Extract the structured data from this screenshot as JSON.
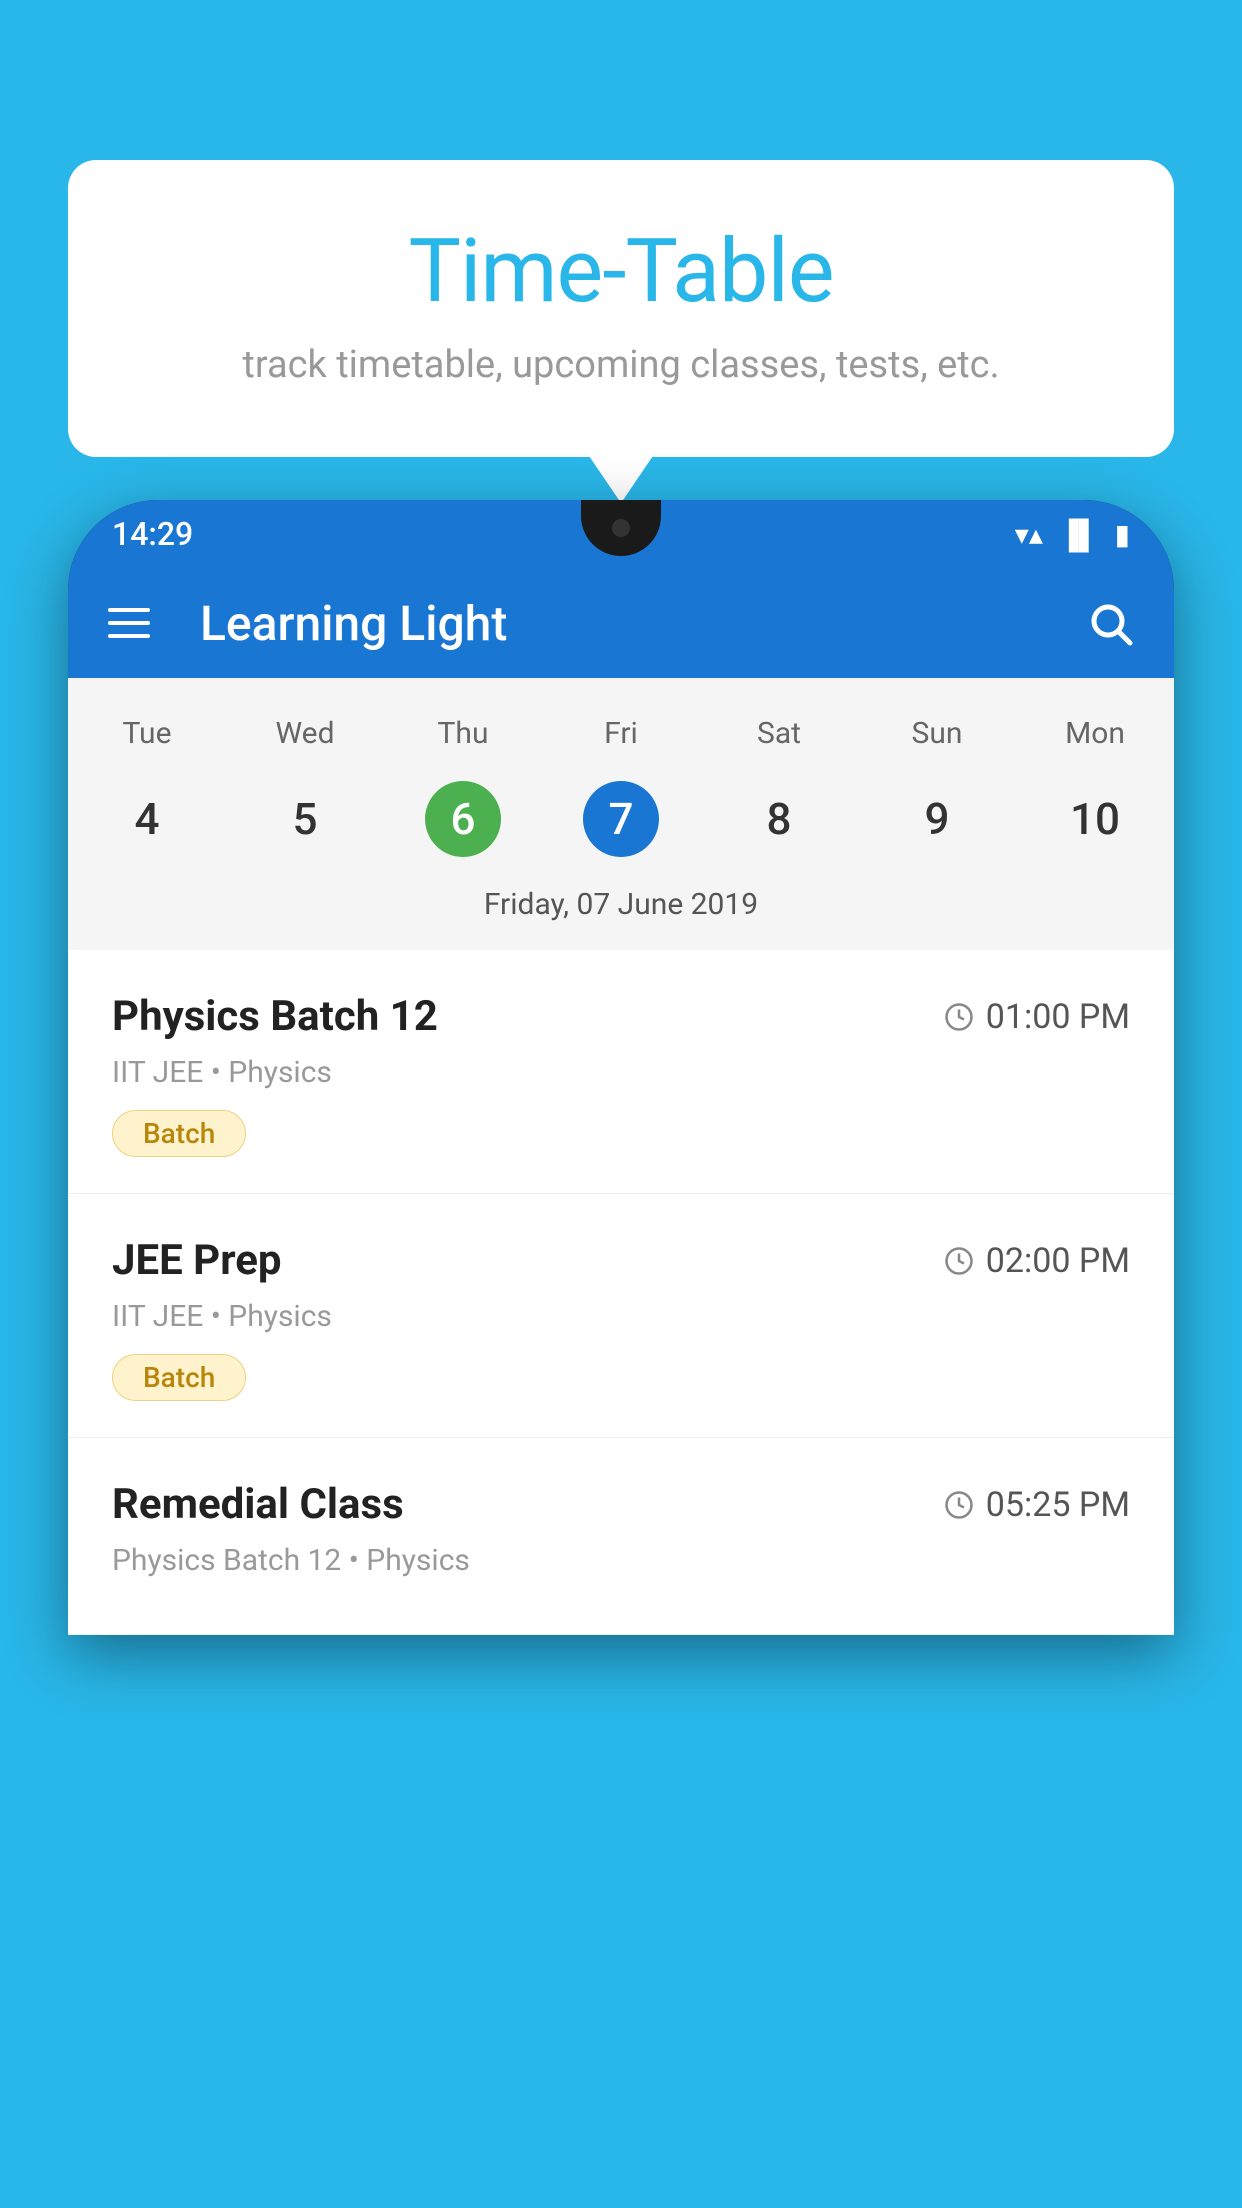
{
  "page": {
    "background_color": "#29B6E8"
  },
  "bubble": {
    "title": "Time-Table",
    "subtitle": "track timetable, upcoming classes, tests, etc."
  },
  "status_bar": {
    "time": "14:29",
    "icons": [
      "wifi",
      "signal",
      "battery"
    ]
  },
  "app_bar": {
    "title": "Learning Light",
    "menu_icon": "menu",
    "search_icon": "search"
  },
  "calendar": {
    "days": [
      "Tue",
      "Wed",
      "Thu",
      "Fri",
      "Sat",
      "Sun",
      "Mon"
    ],
    "dates": [
      "4",
      "5",
      "6",
      "7",
      "8",
      "9",
      "10"
    ],
    "today_index": 2,
    "selected_index": 3,
    "selected_date_label": "Friday, 07 June 2019"
  },
  "schedule_items": [
    {
      "name": "Physics Batch 12",
      "time": "01:00 PM",
      "meta": "IIT JEE • Physics",
      "tag": "Batch"
    },
    {
      "name": "JEE Prep",
      "time": "02:00 PM",
      "meta": "IIT JEE • Physics",
      "tag": "Batch"
    },
    {
      "name": "Remedial Class",
      "time": "05:25 PM",
      "meta": "Physics Batch 12 • Physics",
      "tag": null
    }
  ]
}
